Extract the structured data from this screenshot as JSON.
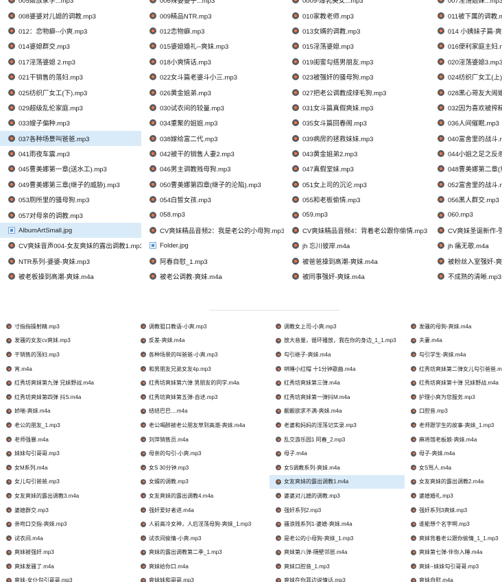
{
  "top_panel": {
    "files": [
      {
        "name": "005姬放家学...mp3",
        "type": "audio"
      },
      {
        "name": "008婆婆对儿媳的调教.mp3",
        "type": "audio"
      },
      {
        "name": "012：恋物癖--小爽.mp3",
        "type": "audio"
      },
      {
        "name": "014婆媳群交.mp3",
        "type": "audio"
      },
      {
        "name": "017淫荡婆媳 2.mp3",
        "type": "audio"
      },
      {
        "name": "021干销售的落妇.mp3",
        "type": "audio"
      },
      {
        "name": "025纺织厂女工(下).mp3",
        "type": "audio"
      },
      {
        "name": "029超级乱伦家庭.mp3",
        "type": "audio"
      },
      {
        "name": "033嫂子偏种.mp3",
        "type": "audio"
      },
      {
        "name": "037各种场景叫爸爸.mp3",
        "type": "audio",
        "selected": true
      },
      {
        "name": "041雨夜车震.mp3",
        "type": "audio"
      },
      {
        "name": "045曹美娜第一章(送水工).mp3",
        "type": "audio"
      },
      {
        "name": "049曹美娜第三章(继子的威胁).mp3",
        "type": "audio"
      },
      {
        "name": "053厕所里的骚母狗.mp3",
        "type": "audio"
      },
      {
        "name": "057对母亲的调教.mp3",
        "type": "audio"
      },
      {
        "name": "AlbumArtSmall.jpg",
        "type": "image",
        "selected": true
      },
      {
        "name": "CV爽妹音声004-女友爽妹的露出调教1.mp3",
        "type": "audio"
      },
      {
        "name": "NTR系列-婆婆-爽妹.mp3",
        "type": "audio"
      },
      {
        "name": "被老板操到高潮-爽妹.m4a",
        "type": "audio"
      },
      {
        "name": "006辣婆婆子...mp3",
        "type": "audio"
      },
      {
        "name": "009精品NTR.mp3",
        "type": "audio"
      },
      {
        "name": "012恋物癖.mp3",
        "type": "audio"
      },
      {
        "name": "015婆媳婚礼--爽妹.mp3",
        "type": "audio"
      },
      {
        "name": "018小爽情话.mp3",
        "type": "audio"
      },
      {
        "name": "022女斗篇老婆斗小三.mp3",
        "type": "audio"
      },
      {
        "name": "026黄金姐弟.mp3",
        "type": "audio"
      },
      {
        "name": "030试衣间的较量.mp3",
        "type": "audio"
      },
      {
        "name": "034重聚的姐姐.mp3",
        "type": "audio"
      },
      {
        "name": "038嫁给富二代.mp3",
        "type": "audio"
      },
      {
        "name": "042被干的销售人妻2.mp3",
        "type": "audio"
      },
      {
        "name": "046男主调教贱母狗.mp3",
        "type": "audio"
      },
      {
        "name": "050曹美娜第四章(继子的沦陷).mp3",
        "type": "audio"
      },
      {
        "name": "054白皙女孩.mp3",
        "type": "audio"
      },
      {
        "name": "058.mp3",
        "type": "audio"
      },
      {
        "name": "CV爽妹精品音频2：我是老公的小母狗.mp3",
        "type": "audio"
      },
      {
        "name": "Folder.jpg",
        "type": "image"
      },
      {
        "name": "阿春自慰_1.mp3",
        "type": "audio"
      },
      {
        "name": "被老公调教-爽妹.m4a",
        "type": "audio"
      },
      {
        "name": "0009-爆乳美女...mp3",
        "type": "audio"
      },
      {
        "name": "010家教老师.mp3",
        "type": "audio"
      },
      {
        "name": "013女婿的调教.mp3",
        "type": "audio"
      },
      {
        "name": "015淫荡婆媳.mp3",
        "type": "audio"
      },
      {
        "name": "019闺蜜勾搭男朋友.mp3",
        "type": "audio"
      },
      {
        "name": "023被强奸的骚母狗.mp3",
        "type": "audio"
      },
      {
        "name": "027把老公调教成绿毛狗.mp3",
        "type": "audio"
      },
      {
        "name": "031女斗篇真假爽妹.mp3",
        "type": "audio"
      },
      {
        "name": "035女斗篇回春阁.mp3",
        "type": "audio"
      },
      {
        "name": "039病房的拯救妹妹.mp3",
        "type": "audio"
      },
      {
        "name": "043黄金姐弟2.mp3",
        "type": "audio"
      },
      {
        "name": "047真假堂妹.mp3",
        "type": "audio"
      },
      {
        "name": "051女上司的沉沦.mp3",
        "type": "audio"
      },
      {
        "name": "055和老板偷情.mp3",
        "type": "audio"
      },
      {
        "name": "059.mp3",
        "type": "audio"
      },
      {
        "name": "CV爽妹精品音频4：背着老公跟你偷情.mp3",
        "type": "audio"
      },
      {
        "name": "jh 忘川彼岸.m4a",
        "type": "audio"
      },
      {
        "name": "被爸爸操到高潮-爽妹.m4a",
        "type": "audio"
      },
      {
        "name": "被同事强奸-爽妹.m4a",
        "type": "audio"
      },
      {
        "name": "007淫荡姐妹...mp3",
        "type": "audio"
      },
      {
        "name": "011被下属的调教.mp3",
        "type": "audio"
      },
      {
        "name": "014 小姨妹子篇-爽妹.mp3",
        "type": "audio"
      },
      {
        "name": "016便利家庭主妇.mp3",
        "type": "audio"
      },
      {
        "name": "020淫荡婆媳3.mp3",
        "type": "audio"
      },
      {
        "name": "024纺织厂女工(上).mp3",
        "type": "audio"
      },
      {
        "name": "028黑心哥友大闹婚礼.mp3",
        "type": "audio"
      },
      {
        "name": "032因为喜欢被搾精.mp3",
        "type": "audio"
      },
      {
        "name": "036人间催眠.mp3",
        "type": "audio"
      },
      {
        "name": "040富舍里的战斗.mp3",
        "type": "audio"
      },
      {
        "name": "044小姐之足之反杀.mp3",
        "type": "audio"
      },
      {
        "name": "048曹美娜第二章(意外的发现).mp3",
        "type": "audio"
      },
      {
        "name": "052富舍里的战斗.mp3",
        "type": "audio"
      },
      {
        "name": "056黑人群交.mp3",
        "type": "audio"
      },
      {
        "name": "060.mp3",
        "type": "audio"
      },
      {
        "name": "CV爽妹圣诞新作-强奸系列.mp3",
        "type": "audio"
      },
      {
        "name": "jh 痛无歌.m4a",
        "type": "audio"
      },
      {
        "name": "被粉丝入室强奸-爽妹.m4a",
        "type": "audio"
      },
      {
        "name": "不成熟的清晰.mp3",
        "type": "audio"
      }
    ]
  },
  "bottom_panel": {
    "files": [
      {
        "name": "寸指指操射精.mp3",
        "type": "audio"
      },
      {
        "name": "发骚的女友cv爽妹.mp3",
        "type": "audio"
      },
      {
        "name": "干销售的荡妇.mp3",
        "type": "audio"
      },
      {
        "name": "宵.m4a",
        "type": "audio"
      },
      {
        "name": "红秀坊爽妹第九弹 兄妹野战.m4a",
        "type": "audio"
      },
      {
        "name": "红秀坊爽妹第四弹 抖S.m4a",
        "type": "audio"
      },
      {
        "name": "娇喘-爽妹.m4a",
        "type": "audio"
      },
      {
        "name": "老公的朋友_1.mp3",
        "type": "audio"
      },
      {
        "name": "老师强暴.m4a",
        "type": "audio"
      },
      {
        "name": "妹妹勾引哥哥.mp3",
        "type": "audio"
      },
      {
        "name": "女M系列.m4a",
        "type": "audio"
      },
      {
        "name": "女儿勾引爸爸.mp3",
        "type": "audio"
      },
      {
        "name": "女友爽妹的露出调教3.m4a",
        "type": "audio"
      },
      {
        "name": "婆媳群交.mp3",
        "type": "audio"
      },
      {
        "name": "亲吻口交指-爽妹.mp3",
        "type": "audio"
      },
      {
        "name": "试衣间.m4a",
        "type": "audio"
      },
      {
        "name": "爽妹被强奸.mp3",
        "type": "audio"
      },
      {
        "name": "爽妹发骚了.m4a",
        "type": "audio"
      },
      {
        "name": "爽妹-女仆勾引哥哥.mp3",
        "type": "audio"
      },
      {
        "name": "调教狙口教语-小爽.mp3",
        "type": "audio"
      },
      {
        "name": "反差-爽妹.m4a",
        "type": "audio"
      },
      {
        "name": "各种场景的叫爸爸-小爽.mp3",
        "type": "audio"
      },
      {
        "name": "和男朋友兄弟女友4p.mp3",
        "type": "audio"
      },
      {
        "name": "红秀坊爽妹第六弹 男朋友的同学.m4a",
        "type": "audio"
      },
      {
        "name": "红秀坊爽妹第五弹-自述.mp3",
        "type": "audio"
      },
      {
        "name": "结结巴巴....m4a",
        "type": "audio"
      },
      {
        "name": "老公喝醉被老公朋友草到高潮-爽妹.m4a",
        "type": "audio"
      },
      {
        "name": "刘萍销售员.m4a",
        "type": "audio"
      },
      {
        "name": "母亲的勾引-小爽.mp3",
        "type": "audio"
      },
      {
        "name": "女S 30分钟.mp3",
        "type": "audio"
      },
      {
        "name": "女婿的调教.mp3",
        "type": "audio"
      },
      {
        "name": "女友爽妹的露出调教4.m4a",
        "type": "audio"
      },
      {
        "name": "强奸爱好者进.m4a",
        "type": "audio"
      },
      {
        "name": "人前高冷女神，人后淫荡母狗-爽妹_1.mp3",
        "type": "audio"
      },
      {
        "name": "试衣间偷情-小爽.mp3",
        "type": "audio"
      },
      {
        "name": "爽妹的露出调教第二季_1.mp3",
        "type": "audio"
      },
      {
        "name": "爽妹给你口.m4a",
        "type": "audio"
      },
      {
        "name": "爽妹妹和哥哥.mp3",
        "type": "audio"
      },
      {
        "name": "调教女上司-小爽.mp3",
        "type": "audio"
      },
      {
        "name": "放大音量，循环播放，我在你的身边_1_1.mp3",
        "type": "audio"
      },
      {
        "name": "勾引继子-爽妹.m4a",
        "type": "audio"
      },
      {
        "name": "哄睡小红帽 十1分钟歌曲.m4a",
        "type": "audio"
      },
      {
        "name": "红秀坊爽妹第三弹.m4a",
        "type": "audio"
      },
      {
        "name": "红秀坊爽妹第一弹抖M.m4a",
        "type": "audio"
      },
      {
        "name": "靓靓欲求不满-爽妹.m4a",
        "type": "audio"
      },
      {
        "name": "老婆和妈妈的淫荡记实录.mp3",
        "type": "audio"
      },
      {
        "name": "乱交游乐园1 阿春_2.mp3",
        "type": "audio"
      },
      {
        "name": "母子.m4a",
        "type": "audio"
      },
      {
        "name": "女S调教系列-爽妹.m4a",
        "type": "audio"
      },
      {
        "name": "女友爽妹的露出调教1.m4a",
        "type": "audio",
        "selected": true
      },
      {
        "name": "婆婆对儿媳的调教.mp3",
        "type": "audio"
      },
      {
        "name": "强奸系列2.mp3",
        "type": "audio"
      },
      {
        "name": "骚浪贱系列1-婆媳-爽妹.m4a",
        "type": "audio"
      },
      {
        "name": "是老公的小母狗-爽妹_1.mp3",
        "type": "audio"
      },
      {
        "name": "爽妹第八弹-隔壁邻居.m4a",
        "type": "audio"
      },
      {
        "name": "爽妹口腔音_1.mp3",
        "type": "audio"
      },
      {
        "name": "爽妹在你耳边说情话.mp3",
        "type": "audio"
      },
      {
        "name": "发骚的母狗-爽妹.m4a",
        "type": "audio"
      },
      {
        "name": "夫妻.m4a",
        "type": "audio"
      },
      {
        "name": "勾引学生-爽妹.m4a",
        "type": "audio"
      },
      {
        "name": "红秀坊爽妹第二弹女儿勾引爸爸.m4a",
        "type": "audio"
      },
      {
        "name": "红秀坊爽妹第十弹 兄妹野战.m4a",
        "type": "audio"
      },
      {
        "name": "护理小爽为您服务.mp3",
        "type": "audio"
      },
      {
        "name": "口腔音.mp3",
        "type": "audio"
      },
      {
        "name": "老师跟学生的故事-爽妹_1.mp3",
        "type": "audio"
      },
      {
        "name": "麻将馆老板娘-爽妹.m4a",
        "type": "audio"
      },
      {
        "name": "母子-爽妹.m4a",
        "type": "audio"
      },
      {
        "name": "女S骂人.m4a",
        "type": "audio"
      },
      {
        "name": "女友爽妹的露出调教2.m4a",
        "type": "audio"
      },
      {
        "name": "婆媳婚礼.mp3",
        "type": "audio"
      },
      {
        "name": "强奸系列3爽妹.mp3",
        "type": "audio"
      },
      {
        "name": "谁能想个名字啊.mp3",
        "type": "audio"
      },
      {
        "name": "爽妹背着老公跟你偷情_1_1.mp3",
        "type": "audio"
      },
      {
        "name": "爽妹第七弹-伴你入睡.m4a",
        "type": "audio"
      },
      {
        "name": "爽妹--妹妹勾引哥哥.mp3",
        "type": "audio"
      },
      {
        "name": "爽妹自慰.m4a",
        "type": "audio"
      }
    ]
  }
}
